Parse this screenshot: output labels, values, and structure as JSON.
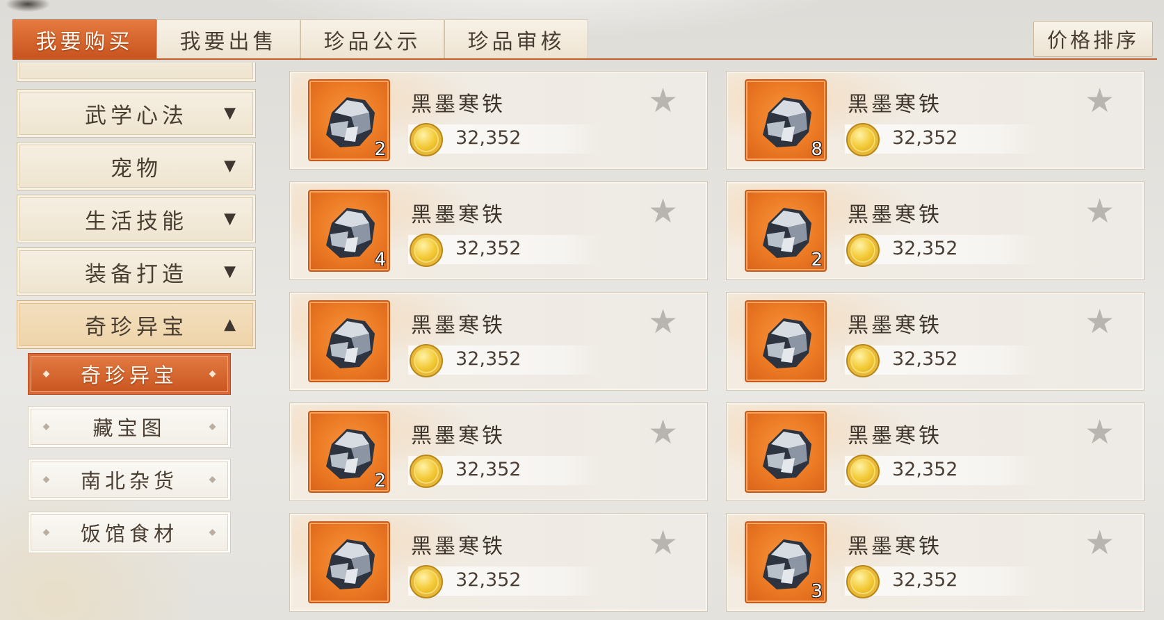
{
  "tabs": [
    {
      "label": "我要购买",
      "active": true
    },
    {
      "label": "我要出售",
      "active": false
    },
    {
      "label": "珍品公示",
      "active": false
    },
    {
      "label": "珍品审核",
      "active": false
    }
  ],
  "sort_label": "价格排序",
  "sidebar": {
    "categories": [
      {
        "label": "武学心法",
        "state": "collapsed"
      },
      {
        "label": "宠物",
        "state": "collapsed"
      },
      {
        "label": "生活技能",
        "state": "collapsed"
      },
      {
        "label": "装备打造",
        "state": "collapsed"
      },
      {
        "label": "奇珍异宝",
        "state": "expanded"
      }
    ],
    "subcategories": [
      {
        "label": "奇珍异宝",
        "active": true
      },
      {
        "label": "藏宝图",
        "active": false
      },
      {
        "label": "南北杂货",
        "active": false
      },
      {
        "label": "饭馆食材",
        "active": false
      }
    ]
  },
  "items": [
    {
      "name": "黑墨寒铁",
      "price": "32,352",
      "qty": "2"
    },
    {
      "name": "黑墨寒铁",
      "price": "32,352",
      "qty": "8"
    },
    {
      "name": "黑墨寒铁",
      "price": "32,352",
      "qty": "4"
    },
    {
      "name": "黑墨寒铁",
      "price": "32,352",
      "qty": "2"
    },
    {
      "name": "黑墨寒铁",
      "price": "32,352",
      "qty": ""
    },
    {
      "name": "黑墨寒铁",
      "price": "32,352",
      "qty": ""
    },
    {
      "name": "黑墨寒铁",
      "price": "32,352",
      "qty": "2"
    },
    {
      "name": "黑墨寒铁",
      "price": "32,352",
      "qty": ""
    },
    {
      "name": "黑墨寒铁",
      "price": "32,352",
      "qty": ""
    },
    {
      "name": "黑墨寒铁",
      "price": "32,352",
      "qty": "3"
    }
  ],
  "icons": {
    "item": "iron-ore-icon",
    "currency": "gold-coin-icon",
    "favorite": "star-icon",
    "expand": "triangle-down-icon",
    "collapse": "triangle-up-icon"
  },
  "colors": {
    "accent": "#c8541f",
    "item_icon_bg": "#ec7a24",
    "coin": "#f3c935"
  }
}
